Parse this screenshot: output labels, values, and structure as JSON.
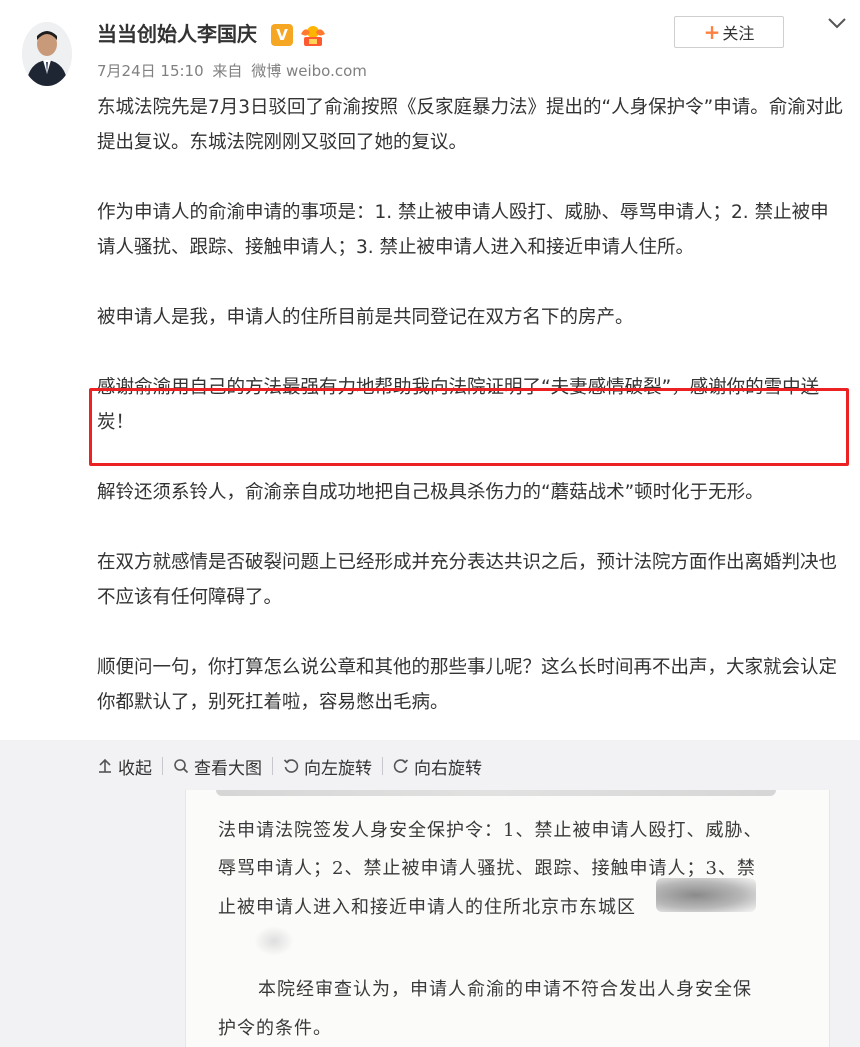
{
  "post": {
    "author": "当当创始人李国庆",
    "verified_badge": "V",
    "date": "7月24日 15:10",
    "source_prefix": "来自",
    "source": "微博 weibo.com",
    "follow_label": "关注",
    "paragraphs": [
      "东城法院先是7月3日驳回了俞渝按照《反家庭暴力法》提出的“人身保护令”申请。俞渝对此提出复议。东城法院刚刚又驳回了她的复议。",
      "作为申请人的俞渝申请的事项是：1. 禁止被申请人殴打、威胁、辱骂申请人；2. 禁止被申请人骚扰、跟踪、接触申请人；3. 禁止被申请人进入和接近申请人住所。",
      "被申请人是我，申请人的住所目前是共同登记在双方名下的房产。",
      "感谢俞渝用自己的方法最强有力地帮助我向法院证明了“夫妻感情破裂”，感谢你的雪中送炭！",
      "解铃还须系铃人，俞渝亲自成功地把自己极具杀伤力的“蘑菇战术”顿时化于无形。",
      "在双方就感情是否破裂问题上已经形成并充分表达共识之后，预计法院方面作出离婚判决也不应该有任何障碍了。",
      "顺便问一句，你打算怎么说公章和其他的那些事儿呢？这么长时间再不出声，大家就会认定你都默认了，别死扛着啦，容易憋出毛病。"
    ]
  },
  "toolbar": {
    "collapse": "收起",
    "view_large": "查看大图",
    "rotate_left": "向左旋转",
    "rotate_right": "向右旋转"
  },
  "document_image": {
    "lines": [
      "法申请法院签发人身安全保护令：1、禁止被申请人殴打、威胁、",
      "辱骂申请人；2、禁止被申请人骚扰、跟踪、接触申请人；3、禁",
      "止被申请人进入和接近申请人的住所北京市东城区",
      "本院经审查认为，申请人俞渝的申请不符合发出人身安全保",
      "护令的条件。"
    ]
  },
  "colors": {
    "highlight_border": "#ec2222",
    "accent_orange": "#ff8140",
    "verified": "#f5a623"
  }
}
